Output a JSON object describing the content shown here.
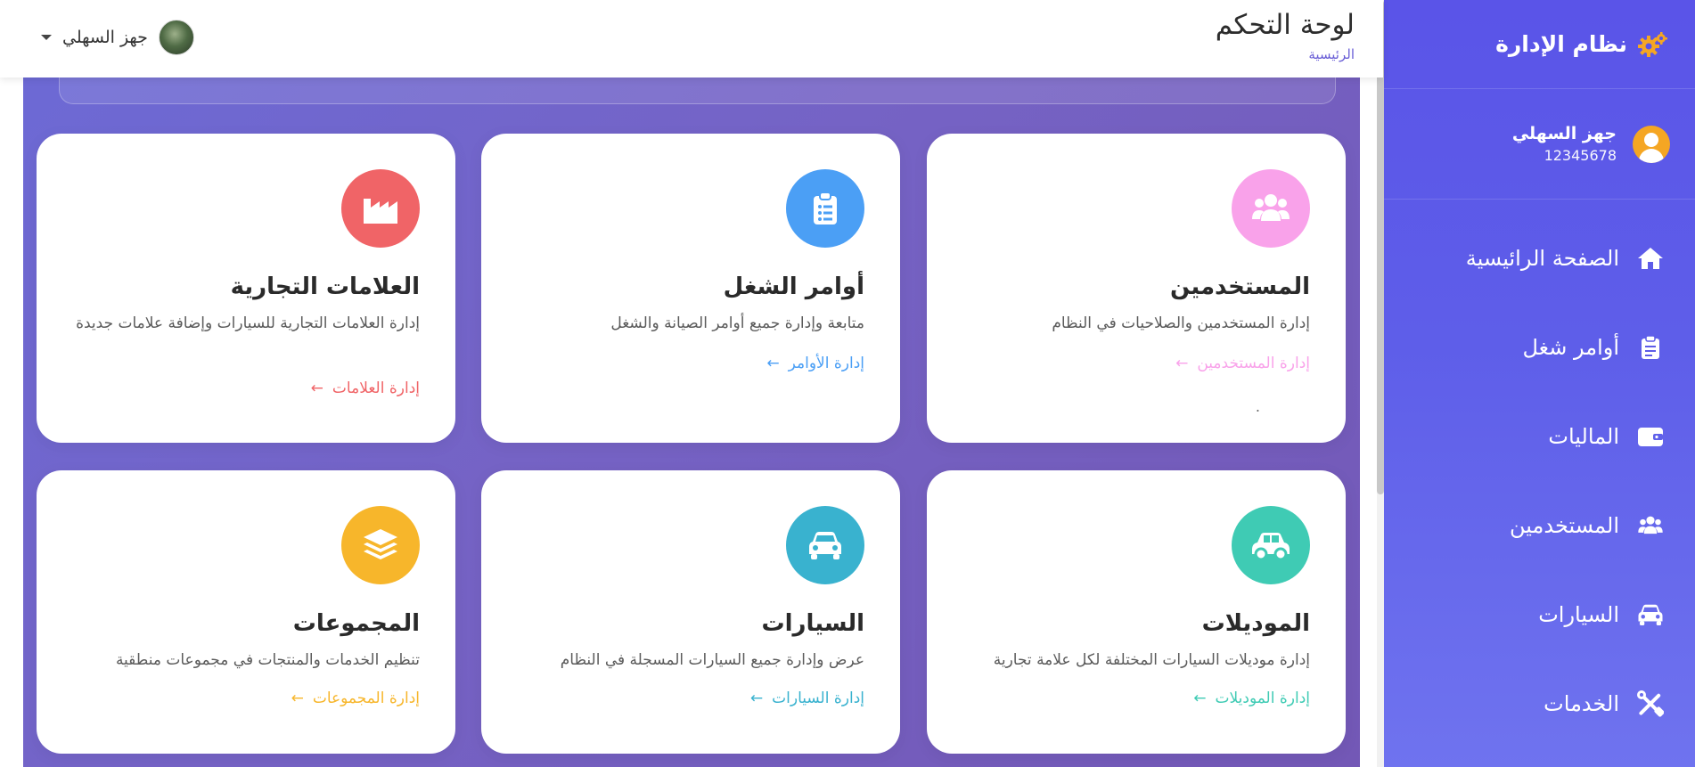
{
  "sidebar": {
    "brand": "نظام الإدارة",
    "user_name": "جهز السهلي",
    "user_phone": "12345678",
    "items": [
      {
        "label": "الصفحة الرائيسية",
        "icon": "home-icon"
      },
      {
        "label": "أوامر شغل",
        "icon": "clipboard-icon"
      },
      {
        "label": "الماليات",
        "icon": "wallet-icon"
      },
      {
        "label": "المستخدمين",
        "icon": "users-icon"
      },
      {
        "label": "السيارات",
        "icon": "car-icon"
      },
      {
        "label": "الخدمات",
        "icon": "tools-icon"
      }
    ]
  },
  "header": {
    "title": "لوحة التحكم",
    "breadcrumb": "الرئيسية",
    "profile_name": "جهز السهلي"
  },
  "cards": [
    {
      "title": "المستخدمين",
      "desc": "إدارة المستخدمين والصلاحيات في النظام",
      "link": "إدارة المستخدمين",
      "color": "#f9a2ea",
      "icon": "users-icon"
    },
    {
      "title": "أوامر الشغل",
      "desc": "متابعة وإدارة جميع أوامر الصيانة والشغل",
      "link": "إدارة الأوامر",
      "color": "#4b9ff5",
      "icon": "clipboard-list-icon"
    },
    {
      "title": "العلامات التجارية",
      "desc": "إدارة العلامات التجارية للسيارات وإضافة علامات جديدة",
      "link": "إدارة العلامات",
      "color": "#f06467",
      "icon": "factory-icon"
    },
    {
      "title": "الموديلات",
      "desc": "إدارة موديلات السيارات المختلفة لكل علامة تجارية",
      "link": "إدارة الموديلات",
      "color": "#3fcbb4",
      "icon": "car-side-icon"
    },
    {
      "title": "السيارات",
      "desc": "عرض وإدارة جميع السيارات المسجلة في النظام",
      "link": "إدارة السيارات",
      "color": "#39b2cf",
      "icon": "car-icon"
    },
    {
      "title": "المجموعات",
      "desc": "تنظيم الخدمات والمنتجات في مجموعات منطقية",
      "link": "إدارة المجموعات",
      "color": "#f7b62b",
      "icon": "layers-icon"
    }
  ],
  "misc": {
    "dot": "."
  }
}
